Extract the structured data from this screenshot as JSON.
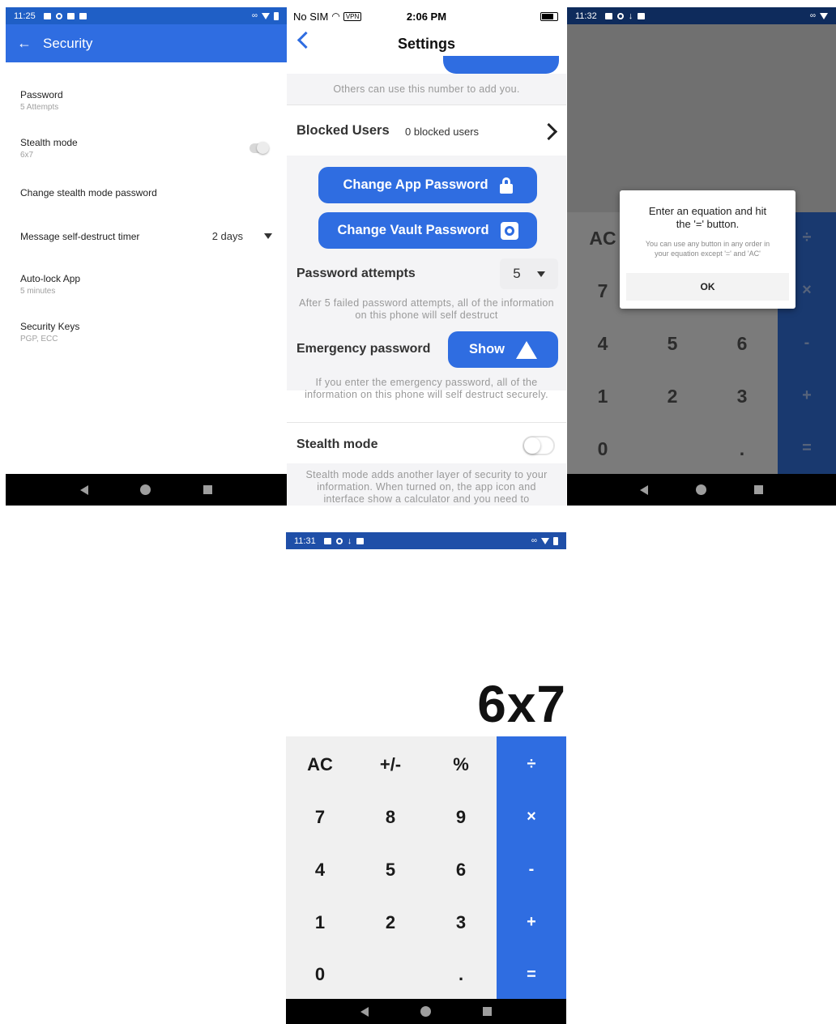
{
  "security_screen": {
    "status_time": "11:25",
    "title": "Security",
    "items": [
      {
        "label": "Password",
        "sub": "5 Attempts"
      },
      {
        "label": "Stealth mode",
        "sub": "6x7"
      },
      {
        "label": "Change stealth mode password",
        "sub": ""
      },
      {
        "label": "Message self-destruct timer",
        "sub": ""
      },
      {
        "label": "Auto-lock App",
        "sub": "5 minutes"
      },
      {
        "label": "Security Keys",
        "sub": "PGP, ECC"
      }
    ],
    "timer_value": "2 days"
  },
  "settings_screen": {
    "carrier": "No SIM",
    "vpn": "VPN",
    "time": "2:06 PM",
    "title": "Settings",
    "add_note": "Others can use this number to add you.",
    "blocked_label": "Blocked Users",
    "blocked_value": "0 blocked users",
    "change_app_password": "Change App Password",
    "change_vault_password": "Change Vault Password",
    "password_attempts_label": "Password attempts",
    "password_attempts_value": "5",
    "attempts_note": "After 5 failed password attempts, all of the information on this phone will self destruct",
    "emergency_label": "Emergency password",
    "show_button": "Show",
    "emergency_note": "If you enter the emergency password, all of the information on this phone will self destruct securely.",
    "stealth_label": "Stealth mode",
    "stealth_note": "Stealth mode adds another layer of security to your information. When turned on, the app icon and interface show a calculator and you need to"
  },
  "calc_dialog_screen": {
    "status_time": "11:32",
    "dialog_title": "Enter an equation and hit the '=' button.",
    "dialog_sub": "You can use any button in any order in your equation except '=' and 'AC'",
    "ok": "OK",
    "keys": {
      "ac": "AC",
      "k7": "7",
      "k4": "4",
      "k5": "5",
      "k6": "6",
      "k1": "1",
      "k2": "2",
      "k3": "3",
      "k0": "0",
      "dot": "."
    },
    "ops": {
      "div": "÷",
      "mul": "×",
      "sub": "-",
      "add": "+",
      "eq": "="
    }
  },
  "calc_screen": {
    "status_time": "11:31",
    "display": "6x7",
    "keys": {
      "ac": "AC",
      "sign": "+/-",
      "pct": "%",
      "k7": "7",
      "k8": "8",
      "k9": "9",
      "k4": "4",
      "k5": "5",
      "k6": "6",
      "k1": "1",
      "k2": "2",
      "k3": "3",
      "k0": "0",
      "dot": "."
    },
    "ops": {
      "div": "÷",
      "mul": "×",
      "sub": "-",
      "add": "+",
      "eq": "="
    }
  },
  "colors": {
    "primary": "#2f6de1",
    "status_dark": "#1f5fc6"
  }
}
